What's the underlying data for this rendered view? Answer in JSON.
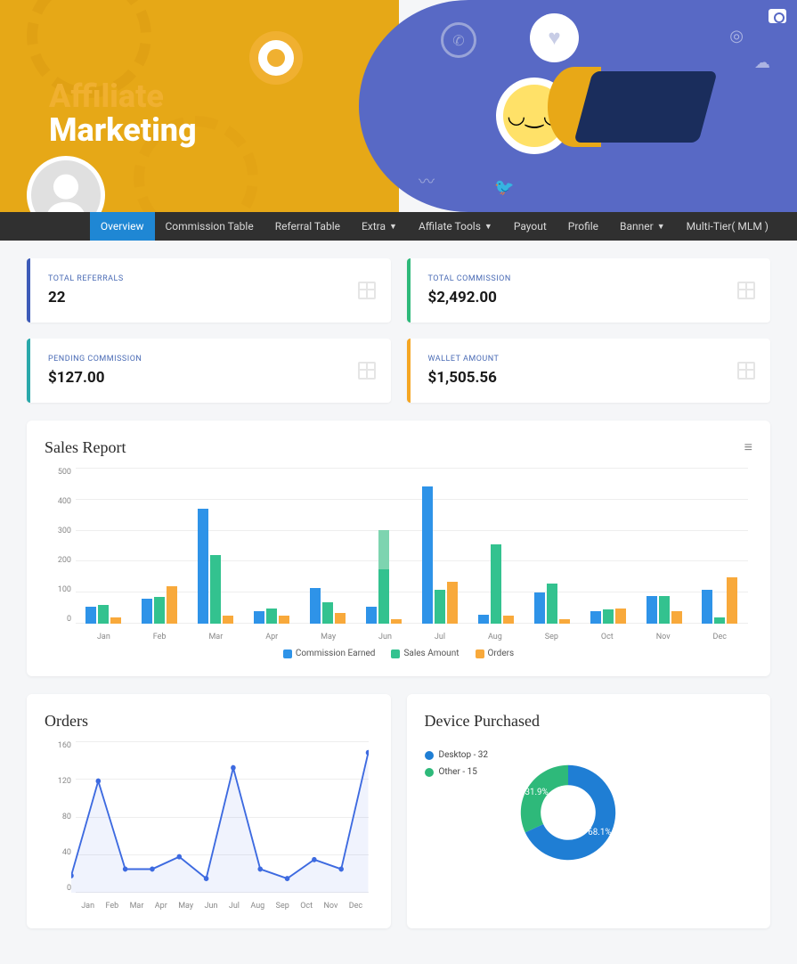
{
  "hero": {
    "line1": "Affiliate",
    "line2": "Marketing"
  },
  "nav": {
    "active": "Overview",
    "items": [
      {
        "label": "Overview",
        "dropdown": false
      },
      {
        "label": "Commission Table",
        "dropdown": false
      },
      {
        "label": "Referral Table",
        "dropdown": false
      },
      {
        "label": "Extra",
        "dropdown": true
      },
      {
        "label": "Affilate Tools",
        "dropdown": true
      },
      {
        "label": "Payout",
        "dropdown": false
      },
      {
        "label": "Profile",
        "dropdown": false
      },
      {
        "label": "Banner",
        "dropdown": true
      },
      {
        "label": "Multi-Tier( MLM )",
        "dropdown": false
      }
    ]
  },
  "cards": [
    {
      "label": "TOTAL REFERRALS",
      "value": "22",
      "color": "#3d5bb8"
    },
    {
      "label": "TOTAL COMMISSION",
      "value": "$2,492.00",
      "color": "#2eb97a"
    },
    {
      "label": "PENDING COMMISSION",
      "value": "$127.00",
      "color": "#2aa8aa"
    },
    {
      "label": "WALLET AMOUNT",
      "value": "$1,505.56",
      "color": "#f5a623"
    }
  ],
  "sales_report": {
    "title": "Sales Report"
  },
  "orders_panel": {
    "title": "Orders"
  },
  "device_panel": {
    "title": "Device Purchased"
  },
  "chart_data": [
    {
      "type": "bar",
      "title": "Sales Report",
      "categories": [
        "Jan",
        "Feb",
        "Mar",
        "Apr",
        "May",
        "Jun",
        "Jul",
        "Aug",
        "Sep",
        "Oct",
        "Nov",
        "Dec"
      ],
      "series": [
        {
          "name": "Commission Earned",
          "color": "#2e93e8",
          "values": [
            55,
            80,
            370,
            40,
            115,
            55,
            440,
            30,
            100,
            40,
            90,
            110
          ]
        },
        {
          "name": "Sales Amount",
          "color": "#33c28f",
          "stacked_top_color": "#7dd4b0",
          "values_base": [
            60,
            85,
            220,
            50,
            70,
            175,
            110,
            255,
            130,
            45,
            90,
            20
          ],
          "values_top": [
            0,
            0,
            0,
            0,
            0,
            125,
            0,
            0,
            0,
            0,
            0,
            0
          ]
        },
        {
          "name": "Orders",
          "color": "#f8a93b",
          "values": [
            20,
            120,
            25,
            25,
            35,
            15,
            135,
            25,
            15,
            50,
            40,
            150
          ]
        }
      ],
      "ylim": [
        0,
        500
      ],
      "yticks": [
        0,
        100,
        200,
        300,
        400,
        500
      ]
    },
    {
      "type": "line",
      "title": "Orders",
      "categories": [
        "Jan",
        "Feb",
        "Mar",
        "Apr",
        "May",
        "Jun",
        "Jul",
        "Aug",
        "Sep",
        "Oct",
        "Nov",
        "Dec"
      ],
      "series": [
        {
          "name": "Orders",
          "color": "#3d6ae0",
          "values": [
            18,
            118,
            25,
            25,
            38,
            15,
            132,
            25,
            15,
            35,
            25,
            148
          ]
        }
      ],
      "ylim": [
        0,
        160
      ],
      "yticks": [
        0,
        40,
        80,
        120,
        160
      ]
    },
    {
      "type": "pie",
      "title": "Device Purchased",
      "series": [
        {
          "name": "Desktop",
          "count": 32,
          "percent": 68.1,
          "color": "#1f7ed4",
          "legend": "Desktop - 32"
        },
        {
          "name": "Other",
          "count": 15,
          "percent": 31.9,
          "color": "#2eb97a",
          "legend": "Other - 15"
        }
      ]
    }
  ]
}
